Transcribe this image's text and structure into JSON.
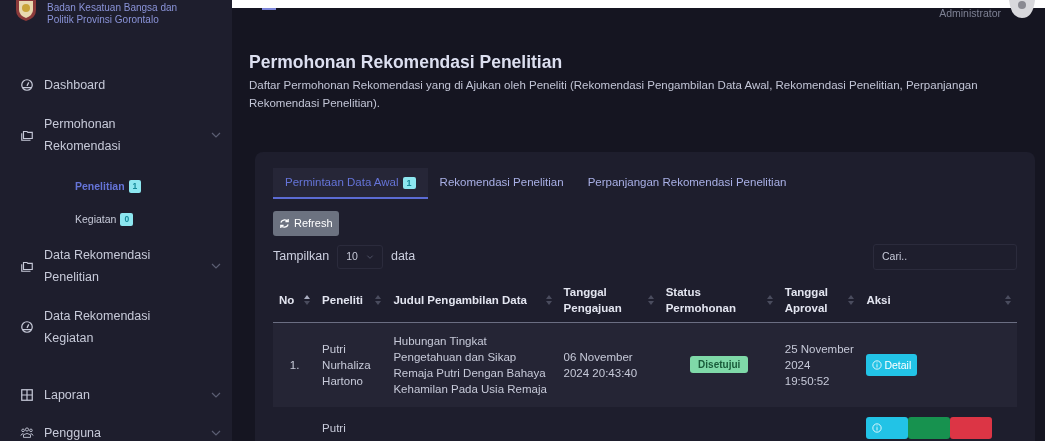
{
  "sidebar": {
    "brand_lines": [
      "Badan Kesatuan Bangsa dan",
      "Politik Provinsi Gorontalo"
    ],
    "items": [
      {
        "kind": "item",
        "label": "Dashboard",
        "expandable": false
      },
      {
        "kind": "item",
        "label": "Permohonan Rekomendasi",
        "expandable": true
      },
      {
        "kind": "sub",
        "label": "Penelitian",
        "badge": "1",
        "selected": true
      },
      {
        "kind": "sub",
        "label": "Kegiatan",
        "badge": "0",
        "selected": false
      },
      {
        "kind": "item",
        "label": "Data Rekomendasi Penelitian",
        "expandable": true
      },
      {
        "kind": "item",
        "label": "Data Rekomendasi Kegiatan",
        "expandable": false
      },
      {
        "kind": "item",
        "label": "Laporan",
        "expandable": true
      },
      {
        "kind": "item",
        "label": "Pengguna",
        "expandable": true
      }
    ]
  },
  "topbar": {
    "user": "Administrator"
  },
  "page": {
    "title": "Permohonan Rekomendasi Penelitian",
    "description": "Daftar Permohonan Rekomendasi yang di Ajukan oleh Peneliti (Rekomendasi Pengambilan Data Awal, Rekomendasi Penelitian, Perpanjangan Rekomendasi Penelitian)."
  },
  "tabs": [
    {
      "label": "Permintaan Data Awal",
      "badge": "1",
      "selected": true
    },
    {
      "label": "Rekomendasi Penelitian",
      "selected": false
    },
    {
      "label": "Perpanjangan Rekomendasi Penelitian",
      "selected": false
    }
  ],
  "refresh_button": "Refresh",
  "length_control": {
    "before": "Tampilkan",
    "value": "10",
    "after": "data"
  },
  "search": {
    "placeholder": "Cari.."
  },
  "table": {
    "columns": [
      {
        "label": "No",
        "sorted": true
      },
      {
        "label": "Peneliti",
        "sorted": false
      },
      {
        "label": "Judul Pengambilan Data",
        "sorted": false
      },
      {
        "label": "Tanggal Pengajuan",
        "sorted": false
      },
      {
        "label": "Status Permohonan",
        "sorted": false
      },
      {
        "label": "Tanggal Aproval",
        "sorted": false
      },
      {
        "label": "Aksi",
        "sorted": false
      }
    ],
    "rows": [
      {
        "no": "1.",
        "peneliti": "Putri Nurhaliza Hartono",
        "judul": "Hubungan Tingkat Pengetahuan dan Sikap Remaja Putri Dengan Bahaya Kehamilan Pada Usia Remaja",
        "tanggal_pengajuan": "06 November 2024 20:43:40",
        "status": {
          "label": "Disetujui",
          "kind": "success"
        },
        "tanggal_aproval": "25 November 2024 19:50:52",
        "actions": [
          {
            "kind": "info",
            "label": "Detail"
          }
        ]
      },
      {
        "peneliti": "Putri",
        "actions": [
          {
            "kind": "info"
          },
          {
            "kind": "success"
          },
          {
            "kind": "danger"
          }
        ]
      }
    ]
  }
}
